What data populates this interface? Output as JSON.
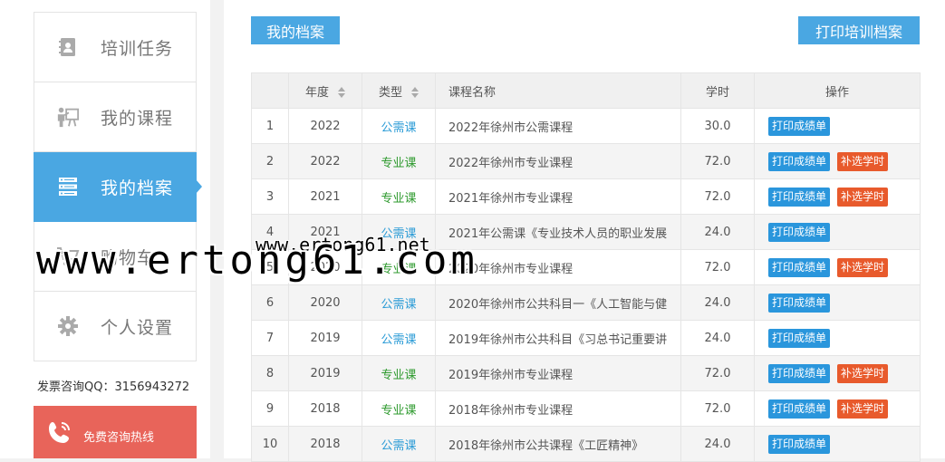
{
  "sidebar": {
    "items": [
      {
        "label": "培训任务",
        "icon": "contacts-book-icon",
        "active": false
      },
      {
        "label": "我的课程",
        "icon": "teacher-board-icon",
        "active": false
      },
      {
        "label": "我的档案",
        "icon": "server-list-icon",
        "active": true
      },
      {
        "label": "购物车",
        "icon": "cart-icon",
        "active": false
      },
      {
        "label": "个人设置",
        "icon": "gear-icon",
        "active": false
      }
    ],
    "qq": "发票咨询QQ：3156943272",
    "hotline": "免费咨询热线"
  },
  "main": {
    "title": "我的档案",
    "print_button": "打印培训档案",
    "columns": [
      "",
      "年度",
      "类型",
      "课程名称",
      "学时",
      "操作"
    ],
    "rows": [
      {
        "no": "1",
        "year": "2022",
        "type": "公需课",
        "name": "2022年徐州市公需课程",
        "hours": "30.0",
        "print": "打印成绩单",
        "add": ""
      },
      {
        "no": "2",
        "year": "2022",
        "type": "专业课",
        "name": "2022年徐州市专业课程",
        "hours": "72.0",
        "print": "打印成绩单",
        "add": "补选学时"
      },
      {
        "no": "3",
        "year": "2021",
        "type": "专业课",
        "name": "2021年徐州市专业课程",
        "hours": "72.0",
        "print": "打印成绩单",
        "add": "补选学时"
      },
      {
        "no": "4",
        "year": "2021",
        "type": "公需课",
        "name": "2021年公需课《专业技术人员的职业发展",
        "hours": "24.0",
        "print": "打印成绩单",
        "add": ""
      },
      {
        "no": "5",
        "year": "2020",
        "type": "专业课",
        "name": "2020年徐州市专业课程",
        "hours": "72.0",
        "print": "打印成绩单",
        "add": "补选学时"
      },
      {
        "no": "6",
        "year": "2020",
        "type": "公需课",
        "name": "2020年徐州市公共科目一《人工智能与健",
        "hours": "24.0",
        "print": "打印成绩单",
        "add": ""
      },
      {
        "no": "7",
        "year": "2019",
        "type": "公需课",
        "name": "2019年徐州市公共科目《习总书记重要讲",
        "hours": "24.0",
        "print": "打印成绩单",
        "add": ""
      },
      {
        "no": "8",
        "year": "2019",
        "type": "专业课",
        "name": "2019年徐州市专业课程",
        "hours": "72.0",
        "print": "打印成绩单",
        "add": "补选学时"
      },
      {
        "no": "9",
        "year": "2018",
        "type": "专业课",
        "name": "2018年徐州市专业课程",
        "hours": "72.0",
        "print": "打印成绩单",
        "add": "补选学时"
      },
      {
        "no": "10",
        "year": "2018",
        "type": "公需课",
        "name": "2018年徐州市公共课程《工匠精神》",
        "hours": "24.0",
        "print": "打印成绩单",
        "add": ""
      }
    ]
  },
  "watermark": {
    "small": "www.ertong61.net",
    "big": "www.ertong61.com"
  },
  "colors": {
    "accent": "#4aa7e2",
    "hotline": "#e8645a",
    "print_btn": "#2a96dc",
    "add_btn": "#e85a2c",
    "public_type": "#2a9bd6",
    "professional_type": "#2e9a2e"
  }
}
